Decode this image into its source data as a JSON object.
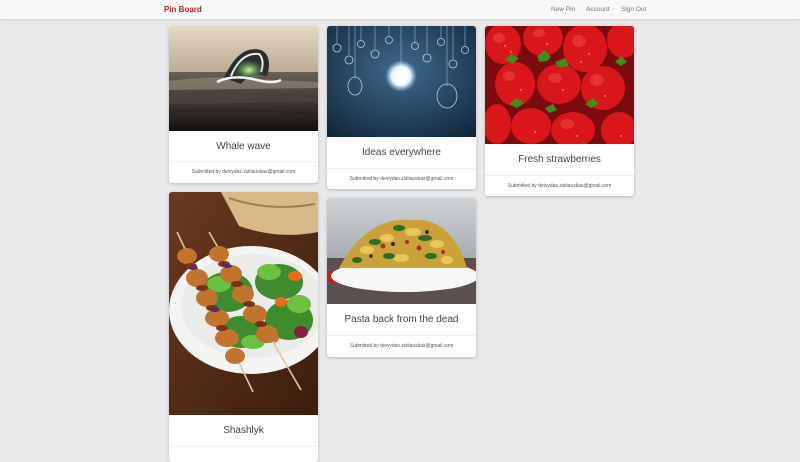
{
  "navbar": {
    "brand": "Pin Board",
    "links": [
      "New Pin",
      "Account",
      "Sign Out"
    ]
  },
  "pins": [
    {
      "title": "Whale wave",
      "submitted": "Submitted by deivydas.zizliauskas@gmail.com"
    },
    {
      "title": "Ideas everywhere",
      "submitted": "Submitted by deivydas.zizliauskas@gmail.com"
    },
    {
      "title": "Fresh strawberries",
      "submitted": "Submitted by deivydas.zizliauskas@gmail.com"
    },
    {
      "title": "Shashlyk",
      "submitted": ""
    },
    {
      "title": "Pasta back from the dead",
      "submitted": "Submitted by deivydas.zizliauskas@gmail.com"
    }
  ],
  "colors": {
    "brand": "#b5232a",
    "background": "#e9e9e9"
  }
}
